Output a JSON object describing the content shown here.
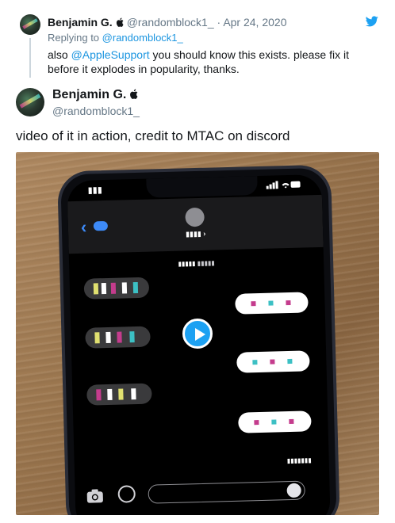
{
  "parent_tweet": {
    "author_name": "Benjamin G.",
    "author_handle": "@randomblock1_",
    "separator": "·",
    "date": "Apr 24, 2020",
    "replying_prefix": "Replying to",
    "replying_to": "@randomblock1_",
    "text_before_mention": "also",
    "mention": "@AppleSupport",
    "text_after_mention": "you should know this exists. please fix it before it explodes in popularity, thanks."
  },
  "main_tweet": {
    "author_name": "Benjamin G.",
    "author_handle": "@randomblock1_",
    "text": "video of it in action, credit to MTAC on discord"
  },
  "icons": {
    "verified_badge": "apple-icon",
    "brand": "twitter-bird-icon",
    "video_control": "play-icon"
  },
  "colors": {
    "link": "#1b95e0",
    "secondary_text": "#657786",
    "primary_text": "#14171a",
    "play_button": "#1da1f2"
  }
}
